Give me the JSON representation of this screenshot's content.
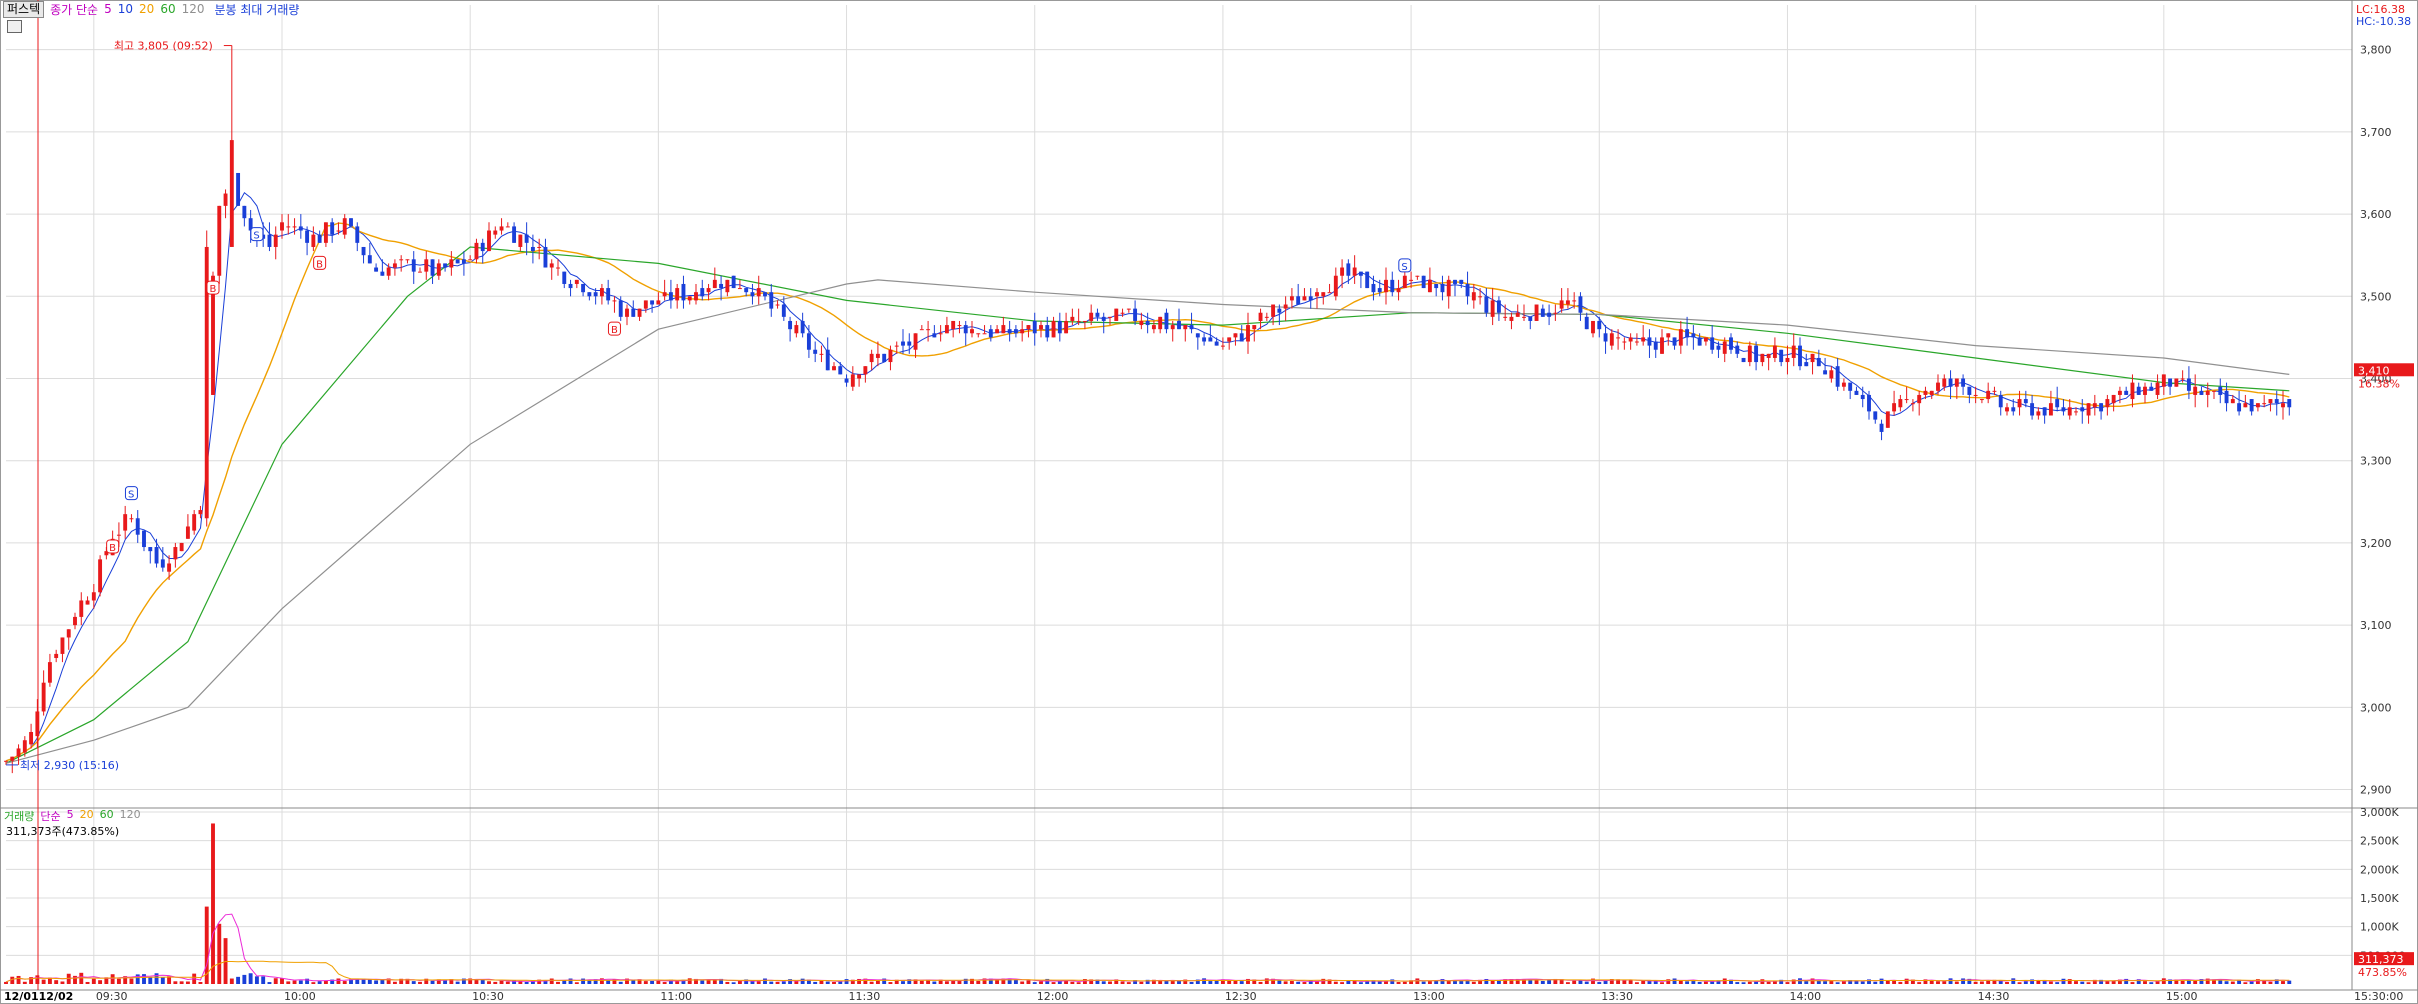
{
  "toolbar": {
    "mode_label": "퍼스텍",
    "ma_label": "종가 단순",
    "ma_periods": [
      "5",
      "10",
      "20",
      "60",
      "120"
    ],
    "volume_toggle": "분봉 최대 거래량"
  },
  "price_panel": {
    "high_annotation": "최고 3,805 (09:52)",
    "low_annotation": "최저 2,930 (15:16)",
    "lc_label": "LC:16.38",
    "hc_label": "HC:-10.38",
    "current_price_badge": "3,410",
    "current_change_badge": "16.38%",
    "y_ticks": [
      "3,800",
      "3,700",
      "3,600",
      "3,500",
      "3,400",
      "3,300",
      "3,200",
      "3,100",
      "3,000",
      "2,900"
    ],
    "signals": [
      {
        "text": "S",
        "t": "09:36",
        "price": 3260
      },
      {
        "text": "B",
        "t": "09:33",
        "price": 3195
      },
      {
        "text": "B",
        "t": "09:49",
        "price": 3510
      },
      {
        "text": "S",
        "t": "09:56",
        "price": 3575
      },
      {
        "text": "B",
        "t": "10:06",
        "price": 3540
      },
      {
        "text": "B",
        "t": "10:53",
        "price": 3460
      },
      {
        "text": "S",
        "t": "12:59",
        "price": 3537
      }
    ]
  },
  "volume_panel": {
    "legend_title": "거래량",
    "legend_ma_label": "단순",
    "legend_periods": [
      "5",
      "20",
      "60",
      "120"
    ],
    "current_volume_text": "311,373주(473.85%)",
    "y_ticks": [
      "3,000K",
      "2,500K",
      "2,000K",
      "1,500K",
      "1,000K",
      "500,000"
    ],
    "current_volume_badge": "311,373",
    "current_volume_pct": "473.85%"
  },
  "x_axis": {
    "date_label": "12/01",
    "date_label2": "12/02",
    "ticks": [
      "09:30",
      "10:00",
      "10:30",
      "11:00",
      "11:30",
      "12:00",
      "12:30",
      "13:00",
      "13:30",
      "14:00",
      "14:30",
      "15:00",
      "15:30:00"
    ]
  },
  "colors": {
    "up": "#e8191b",
    "down": "#1a3fd8",
    "ma5": "#1a3fd8",
    "ma10": "#ec7ee0",
    "ma20": "#f0a000",
    "ma60": "#2aa62a",
    "ma120": "#909090",
    "grid": "#dcdcdc"
  },
  "chart_data": {
    "type": "candlestick",
    "interval": "1 minute",
    "ylim": [
      2880,
      3830
    ],
    "volume_ylim": [
      0,
      3000000
    ],
    "high": {
      "price": 3805,
      "time": "09:52"
    },
    "low": {
      "price": 2930,
      "time": "15:16"
    },
    "prices": [
      [
        "09:16",
        2935
      ],
      [
        "09:20",
        2965
      ],
      [
        "09:22",
        3040
      ],
      [
        "09:25",
        3085
      ],
      [
        "09:28",
        3130
      ],
      [
        "09:30",
        3150
      ],
      [
        "09:33",
        3210
      ],
      [
        "09:36",
        3230
      ],
      [
        "09:40",
        3175
      ],
      [
        "09:43",
        3190
      ],
      [
        "09:47",
        3250
      ],
      [
        "09:48",
        3380
      ],
      [
        "09:49",
        3520
      ],
      [
        "09:50",
        3610
      ],
      [
        "09:52",
        3640
      ],
      [
        "09:55",
        3580
      ],
      [
        "09:58",
        3560
      ],
      [
        "10:00",
        3590
      ],
      [
        "10:05",
        3570
      ],
      [
        "10:10",
        3590
      ],
      [
        "10:15",
        3530
      ],
      [
        "10:20",
        3540
      ],
      [
        "10:25",
        3530
      ],
      [
        "10:30",
        3545
      ],
      [
        "10:35",
        3590
      ],
      [
        "10:40",
        3560
      ],
      [
        "10:45",
        3525
      ],
      [
        "10:50",
        3505
      ],
      [
        "10:55",
        3480
      ],
      [
        "11:00",
        3495
      ],
      [
        "11:05",
        3505
      ],
      [
        "11:10",
        3520
      ],
      [
        "11:15",
        3510
      ],
      [
        "11:20",
        3470
      ],
      [
        "11:25",
        3430
      ],
      [
        "11:30",
        3405
      ],
      [
        "11:35",
        3425
      ],
      [
        "11:40",
        3440
      ],
      [
        "11:45",
        3465
      ],
      [
        "11:50",
        3460
      ],
      [
        "11:55",
        3455
      ],
      [
        "12:00",
        3460
      ],
      [
        "12:05",
        3465
      ],
      [
        "12:10",
        3470
      ],
      [
        "12:15",
        3475
      ],
      [
        "12:20",
        3470
      ],
      [
        "12:25",
        3455
      ],
      [
        "12:30",
        3440
      ],
      [
        "12:35",
        3465
      ],
      [
        "12:40",
        3490
      ],
      [
        "12:45",
        3510
      ],
      [
        "12:50",
        3525
      ],
      [
        "12:55",
        3510
      ],
      [
        "13:00",
        3520
      ],
      [
        "13:05",
        3510
      ],
      [
        "13:10",
        3500
      ],
      [
        "13:15",
        3475
      ],
      [
        "13:20",
        3480
      ],
      [
        "13:25",
        3490
      ],
      [
        "13:30",
        3455
      ],
      [
        "13:35",
        3440
      ],
      [
        "13:40",
        3445
      ],
      [
        "13:45",
        3450
      ],
      [
        "13:50",
        3445
      ],
      [
        "13:55",
        3425
      ],
      [
        "14:00",
        3430
      ],
      [
        "14:05",
        3420
      ],
      [
        "14:10",
        3385
      ],
      [
        "14:15",
        3345
      ],
      [
        "14:20",
        3380
      ],
      [
        "14:25",
        3395
      ],
      [
        "14:30",
        3385
      ],
      [
        "14:35",
        3365
      ],
      [
        "14:40",
        3360
      ],
      [
        "14:45",
        3365
      ],
      [
        "14:50",
        3370
      ],
      [
        "14:55",
        3385
      ],
      [
        "15:00",
        3395
      ],
      [
        "15:05",
        3385
      ],
      [
        "15:10",
        3370
      ],
      [
        "15:15",
        3365
      ],
      [
        "15:20",
        3370
      ]
    ],
    "ma120_trend": [
      [
        "09:16",
        2932
      ],
      [
        "09:30",
        2960
      ],
      [
        "09:45",
        3000
      ],
      [
        "10:00",
        3120
      ],
      [
        "10:30",
        3320
      ],
      [
        "11:00",
        3460
      ],
      [
        "11:30",
        3515
      ],
      [
        "11:35",
        3520
      ],
      [
        "12:00",
        3505
      ],
      [
        "12:30",
        3490
      ],
      [
        "13:00",
        3480
      ],
      [
        "13:30",
        3478
      ],
      [
        "14:00",
        3465
      ],
      [
        "14:30",
        3440
      ],
      [
        "15:00",
        3425
      ],
      [
        "15:20",
        3405
      ]
    ],
    "ma60_trend": [
      [
        "09:16",
        2932
      ],
      [
        "09:30",
        2985
      ],
      [
        "09:45",
        3080
      ],
      [
        "10:00",
        3320
      ],
      [
        "10:20",
        3500
      ],
      [
        "10:30",
        3560
      ],
      [
        "11:00",
        3540
      ],
      [
        "11:30",
        3495
      ],
      [
        "12:00",
        3470
      ],
      [
        "12:30",
        3465
      ],
      [
        "13:00",
        3480
      ],
      [
        "13:30",
        3478
      ],
      [
        "14:00",
        3455
      ],
      [
        "14:30",
        3425
      ],
      [
        "15:00",
        3395
      ],
      [
        "15:20",
        3385
      ]
    ],
    "volume_spikes": [
      [
        "09:48",
        1350000
      ],
      [
        "09:49",
        2800000
      ],
      [
        "09:50",
        1050000
      ],
      [
        "09:51",
        800000
      ]
    ]
  }
}
